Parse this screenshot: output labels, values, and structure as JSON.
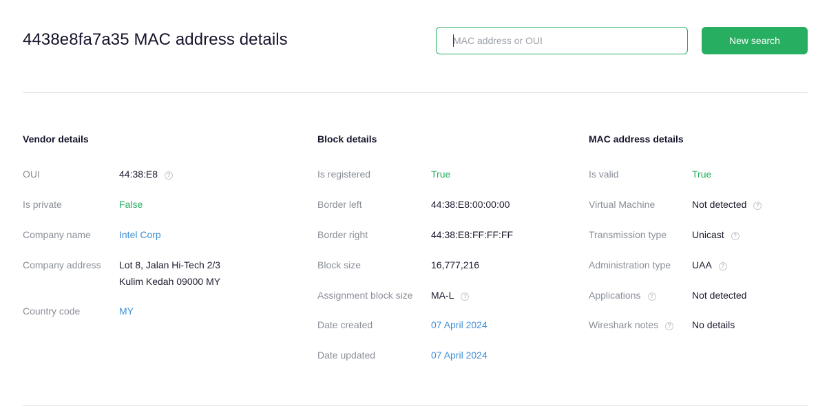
{
  "header": {
    "title": "4438e8fa7a35 MAC address details",
    "search_placeholder": "MAC address or OUI",
    "search_button": "New search"
  },
  "vendor": {
    "title": "Vendor details",
    "oui_label": "OUI",
    "oui_value": "44:38:E8",
    "private_label": "Is private",
    "private_value": "False",
    "company_label": "Company name",
    "company_value": "Intel Corp",
    "address_label": "Company address",
    "address_line1": "Lot 8, Jalan Hi-Tech 2/3",
    "address_line2": "Kulim Kedah 09000 MY",
    "country_label": "Country code",
    "country_value": "MY"
  },
  "block": {
    "title": "Block details",
    "registered_label": "Is registered",
    "registered_value": "True",
    "border_left_label": "Border left",
    "border_left_value": "44:38:E8:00:00:00",
    "border_right_label": "Border right",
    "border_right_value": "44:38:E8:FF:FF:FF",
    "size_label": "Block size",
    "size_value": "16,777,216",
    "assignment_label": "Assignment block size",
    "assignment_value": "MA-L",
    "created_label": "Date created",
    "created_value": "07 April 2024",
    "updated_label": "Date updated",
    "updated_value": "07 April 2024"
  },
  "mac": {
    "title": "MAC address details",
    "valid_label": "Is valid",
    "valid_value": "True",
    "vm_label": "Virtual Machine",
    "vm_value": "Not detected",
    "transmission_label": "Transmission type",
    "transmission_value": "Unicast",
    "admin_label": "Administration type",
    "admin_value": "UAA",
    "applications_label": "Applications",
    "applications_value": "Not detected",
    "wireshark_label": "Wireshark notes",
    "wireshark_value": "No details"
  },
  "icons": {
    "help": "question-circle-icon"
  },
  "colors": {
    "accent": "#27ae60",
    "link": "#3d8fd6",
    "muted": "#8a8f98"
  }
}
